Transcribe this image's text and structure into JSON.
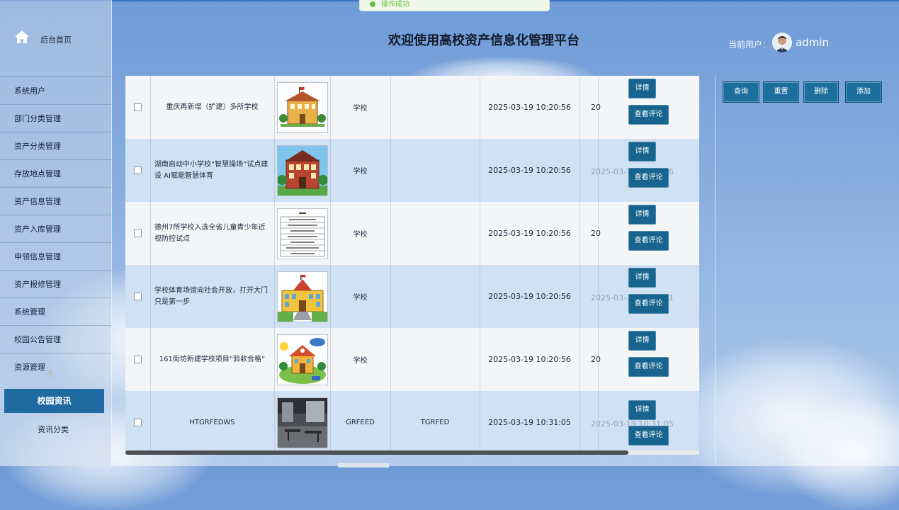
{
  "header": {
    "title": "欢迎使用高校资产信息化管理平台",
    "user_label": "当前用户：",
    "user_name": "admin",
    "toast": "操作成功"
  },
  "sidebar": {
    "home": "后台首页",
    "items": [
      {
        "label": "系统用户"
      },
      {
        "label": "部门分类管理"
      },
      {
        "label": "资产分类管理"
      },
      {
        "label": "存放地点管理"
      },
      {
        "label": "资产信息管理"
      },
      {
        "label": "资产入库管理"
      },
      {
        "label": "申领信息管理"
      },
      {
        "label": "资产报修管理"
      },
      {
        "label": "系统管理"
      },
      {
        "label": "校园公告管理"
      },
      {
        "label": "资源管理"
      }
    ],
    "active": "校园资讯",
    "sub": "资讯分类"
  },
  "table": {
    "detail_label": "详情",
    "comment_label": "查看评论",
    "rows": [
      {
        "title": "重庆再新增（扩建）多所学校",
        "type": "学校",
        "col3": "",
        "date": "2025-03-19 10:20:56",
        "date2": "20",
        "thumb": "school-building",
        "ghost": ""
      },
      {
        "title": "湖南启动中小学校“智慧操场”试点建设 AI赋能智慧体育",
        "type": "学校",
        "col3": "",
        "date": "2025-03-19 10:20:56",
        "date2": "20",
        "thumb": "red-school",
        "ghost": "2025-03-19 10:20:56"
      },
      {
        "title": "德州7所学校入选全省儿童青少年近视防控试点",
        "type": "学校",
        "col3": "",
        "date": "2025-03-19 10:20:56",
        "date2": "20",
        "thumb": "school-list",
        "ghost": ""
      },
      {
        "title": "学校体育场馆向社会开放，打开大门只是第一步",
        "type": "学校",
        "col3": "",
        "date": "2025-03-19 10:20:56",
        "date2": "20",
        "thumb": "yellow-school",
        "ghost": "2025-03-19 10:20:01"
      },
      {
        "title": "161街坊新建学校项目“验收合格”",
        "type": "学校",
        "col3": "",
        "date": "2025-03-19 10:20:56",
        "date2": "20",
        "thumb": "cartoon-school",
        "ghost": ""
      },
      {
        "title": "HTGRFEDWS",
        "type": "GRFEED",
        "col3": "TGRFED",
        "date": "2025-03-19 10:31:05",
        "date2": "20",
        "thumb": "office-room",
        "ghost": "2025-03-19 10:31:05"
      }
    ]
  },
  "actions": {
    "search": "查询",
    "reset": "重置",
    "delete": "删除",
    "add": "添加"
  }
}
